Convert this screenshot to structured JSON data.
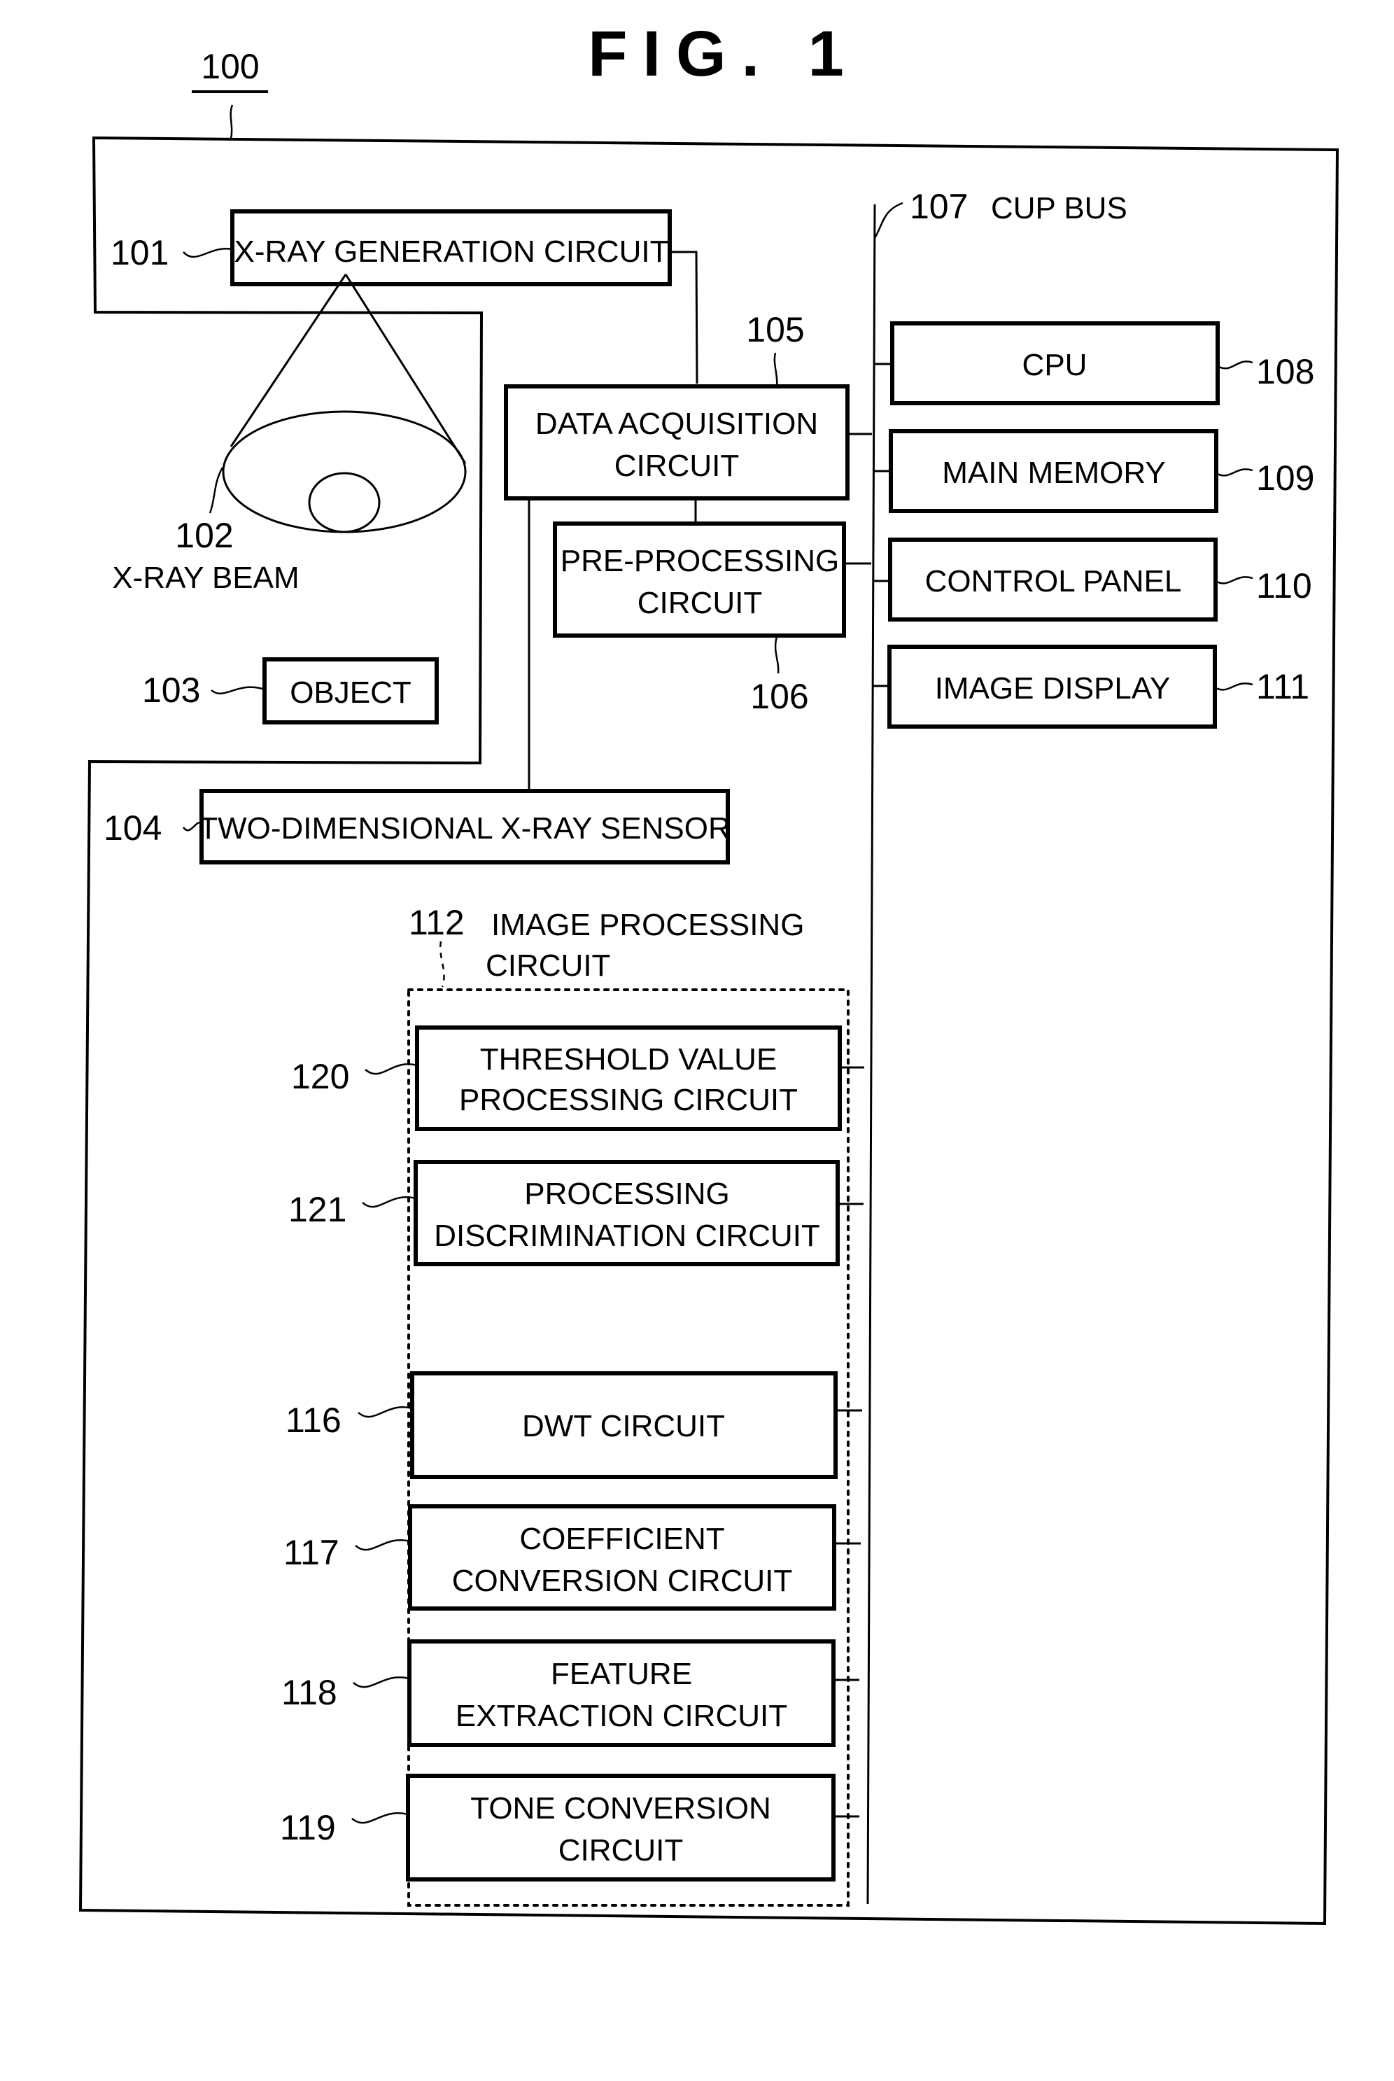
{
  "figure": {
    "title": "FIG. 1",
    "system_ref": "100"
  },
  "components": {
    "xray_generation": {
      "ref": "101",
      "lines": [
        "X-RAY GENERATION CIRCUIT"
      ]
    },
    "xray_beam": {
      "ref": "102",
      "label": "X-RAY BEAM"
    },
    "object": {
      "ref": "103",
      "lines": [
        "OBJECT"
      ]
    },
    "sensor": {
      "ref": "104",
      "lines": [
        "TWO-DIMENSIONAL X-RAY SENSOR"
      ]
    },
    "data_acquisition": {
      "ref": "105",
      "lines": [
        "DATA ACQUISITION",
        "CIRCUIT"
      ]
    },
    "pre_processing": {
      "ref": "106",
      "lines": [
        "PRE-PROCESSING",
        "CIRCUIT"
      ]
    },
    "bus": {
      "ref": "107",
      "label": "CUP BUS"
    },
    "cpu": {
      "ref": "108",
      "lines": [
        "CPU"
      ]
    },
    "main_memory": {
      "ref": "109",
      "lines": [
        "MAIN MEMORY"
      ]
    },
    "control_panel": {
      "ref": "110",
      "lines": [
        "CONTROL PANEL"
      ]
    },
    "image_display": {
      "ref": "111",
      "lines": [
        "IMAGE DISPLAY"
      ]
    },
    "image_processing": {
      "ref": "112",
      "label_lines": [
        "IMAGE PROCESSING",
        "CIRCUIT"
      ]
    },
    "threshold": {
      "ref": "120",
      "lines": [
        "THRESHOLD VALUE",
        "PROCESSING CIRCUIT"
      ]
    },
    "discrimination": {
      "ref": "121",
      "lines": [
        "PROCESSING",
        "DISCRIMINATION CIRCUIT"
      ]
    },
    "dwt": {
      "ref": "116",
      "lines": [
        "DWT CIRCUIT"
      ]
    },
    "coefficient": {
      "ref": "117",
      "lines": [
        "COEFFICIENT",
        "CONVERSION CIRCUIT"
      ]
    },
    "feature": {
      "ref": "118",
      "lines": [
        "FEATURE",
        "EXTRACTION CIRCUIT"
      ]
    },
    "tone": {
      "ref": "119",
      "lines": [
        "TONE CONVERSION",
        "CIRCUIT"
      ]
    }
  }
}
